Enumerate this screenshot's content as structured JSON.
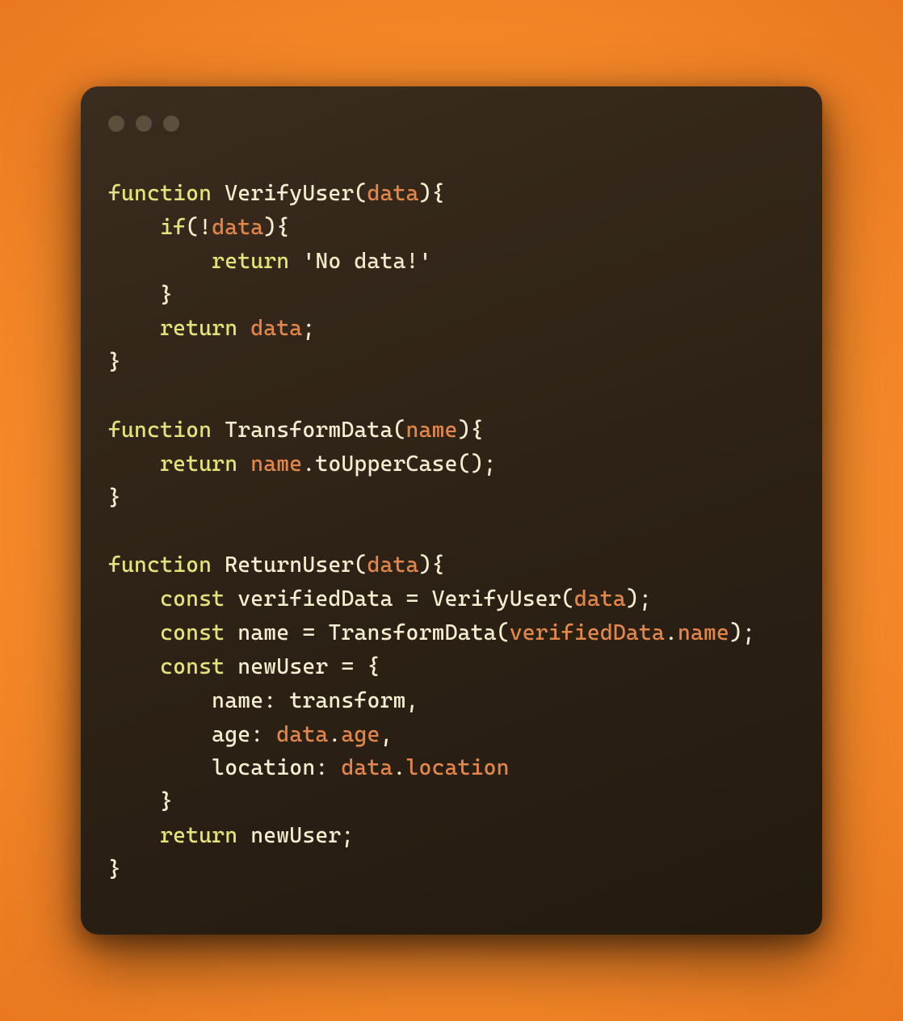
{
  "window": {
    "dots": 3
  },
  "code": {
    "tokens": [
      [
        {
          "t": "function",
          "c": "kw"
        },
        {
          "t": " ",
          "c": "sp"
        },
        {
          "t": "VerifyUser",
          "c": "fn"
        },
        {
          "t": "(",
          "c": "punc"
        },
        {
          "t": "data",
          "c": "param"
        },
        {
          "t": ")",
          "c": "punc"
        },
        {
          "t": "{",
          "c": "punc"
        }
      ],
      [
        {
          "t": "    ",
          "c": "sp"
        },
        {
          "t": "if",
          "c": "kw"
        },
        {
          "t": "(",
          "c": "punc"
        },
        {
          "t": "!",
          "c": "op"
        },
        {
          "t": "data",
          "c": "param"
        },
        {
          "t": ")",
          "c": "punc"
        },
        {
          "t": "{",
          "c": "punc"
        }
      ],
      [
        {
          "t": "        ",
          "c": "sp"
        },
        {
          "t": "return",
          "c": "kw"
        },
        {
          "t": " ",
          "c": "sp"
        },
        {
          "t": "'No data!'",
          "c": "str"
        }
      ],
      [
        {
          "t": "    ",
          "c": "sp"
        },
        {
          "t": "}",
          "c": "punc"
        }
      ],
      [
        {
          "t": "    ",
          "c": "sp"
        },
        {
          "t": "return",
          "c": "kw"
        },
        {
          "t": " ",
          "c": "sp"
        },
        {
          "t": "data",
          "c": "param"
        },
        {
          "t": ";",
          "c": "punc"
        }
      ],
      [
        {
          "t": "}",
          "c": "punc"
        }
      ],
      [],
      [
        {
          "t": "function",
          "c": "kw"
        },
        {
          "t": " ",
          "c": "sp"
        },
        {
          "t": "TransformData",
          "c": "fn"
        },
        {
          "t": "(",
          "c": "punc"
        },
        {
          "t": "name",
          "c": "param"
        },
        {
          "t": ")",
          "c": "punc"
        },
        {
          "t": "{",
          "c": "punc"
        }
      ],
      [
        {
          "t": "    ",
          "c": "sp"
        },
        {
          "t": "return",
          "c": "kw"
        },
        {
          "t": " ",
          "c": "sp"
        },
        {
          "t": "name",
          "c": "param"
        },
        {
          "t": ".",
          "c": "punc"
        },
        {
          "t": "toUpperCase",
          "c": "fn"
        },
        {
          "t": "(",
          "c": "punc"
        },
        {
          "t": ")",
          "c": "punc"
        },
        {
          "t": ";",
          "c": "punc"
        }
      ],
      [
        {
          "t": "}",
          "c": "punc"
        }
      ],
      [],
      [
        {
          "t": "function",
          "c": "kw"
        },
        {
          "t": " ",
          "c": "sp"
        },
        {
          "t": "ReturnUser",
          "c": "fn"
        },
        {
          "t": "(",
          "c": "punc"
        },
        {
          "t": "data",
          "c": "param"
        },
        {
          "t": ")",
          "c": "punc"
        },
        {
          "t": "{",
          "c": "punc"
        }
      ],
      [
        {
          "t": "    ",
          "c": "sp"
        },
        {
          "t": "const",
          "c": "kw"
        },
        {
          "t": " ",
          "c": "sp"
        },
        {
          "t": "verifiedData",
          "c": "fn"
        },
        {
          "t": " ",
          "c": "sp"
        },
        {
          "t": "=",
          "c": "op"
        },
        {
          "t": " ",
          "c": "sp"
        },
        {
          "t": "VerifyUser",
          "c": "fn"
        },
        {
          "t": "(",
          "c": "punc"
        },
        {
          "t": "data",
          "c": "param"
        },
        {
          "t": ")",
          "c": "punc"
        },
        {
          "t": ";",
          "c": "punc"
        }
      ],
      [
        {
          "t": "    ",
          "c": "sp"
        },
        {
          "t": "const",
          "c": "kw"
        },
        {
          "t": " ",
          "c": "sp"
        },
        {
          "t": "name",
          "c": "fn"
        },
        {
          "t": " ",
          "c": "sp"
        },
        {
          "t": "=",
          "c": "op"
        },
        {
          "t": " ",
          "c": "sp"
        },
        {
          "t": "TransformData",
          "c": "fn"
        },
        {
          "t": "(",
          "c": "punc"
        },
        {
          "t": "verifiedData",
          "c": "param"
        },
        {
          "t": ".",
          "c": "punc"
        },
        {
          "t": "name",
          "c": "param"
        },
        {
          "t": ")",
          "c": "punc"
        },
        {
          "t": ";",
          "c": "punc"
        }
      ],
      [
        {
          "t": "    ",
          "c": "sp"
        },
        {
          "t": "const",
          "c": "kw"
        },
        {
          "t": " ",
          "c": "sp"
        },
        {
          "t": "newUser",
          "c": "fn"
        },
        {
          "t": " ",
          "c": "sp"
        },
        {
          "t": "=",
          "c": "op"
        },
        {
          "t": " ",
          "c": "sp"
        },
        {
          "t": "{",
          "c": "punc"
        }
      ],
      [
        {
          "t": "        ",
          "c": "sp"
        },
        {
          "t": "name",
          "c": "prop"
        },
        {
          "t": ":",
          "c": "punc"
        },
        {
          "t": " ",
          "c": "sp"
        },
        {
          "t": "transform",
          "c": "fn"
        },
        {
          "t": ",",
          "c": "punc"
        }
      ],
      [
        {
          "t": "        ",
          "c": "sp"
        },
        {
          "t": "age",
          "c": "prop"
        },
        {
          "t": ":",
          "c": "punc"
        },
        {
          "t": " ",
          "c": "sp"
        },
        {
          "t": "data",
          "c": "param"
        },
        {
          "t": ".",
          "c": "punc"
        },
        {
          "t": "age",
          "c": "param"
        },
        {
          "t": ",",
          "c": "punc"
        }
      ],
      [
        {
          "t": "        ",
          "c": "sp"
        },
        {
          "t": "location",
          "c": "prop"
        },
        {
          "t": ":",
          "c": "punc"
        },
        {
          "t": " ",
          "c": "sp"
        },
        {
          "t": "data",
          "c": "param"
        },
        {
          "t": ".",
          "c": "punc"
        },
        {
          "t": "location",
          "c": "param"
        }
      ],
      [
        {
          "t": "    ",
          "c": "sp"
        },
        {
          "t": "}",
          "c": "punc"
        }
      ],
      [
        {
          "t": "    ",
          "c": "sp"
        },
        {
          "t": "return",
          "c": "kw"
        },
        {
          "t": " ",
          "c": "sp"
        },
        {
          "t": "newUser",
          "c": "fn"
        },
        {
          "t": ";",
          "c": "punc"
        }
      ],
      [
        {
          "t": "}",
          "c": "punc"
        }
      ]
    ]
  }
}
